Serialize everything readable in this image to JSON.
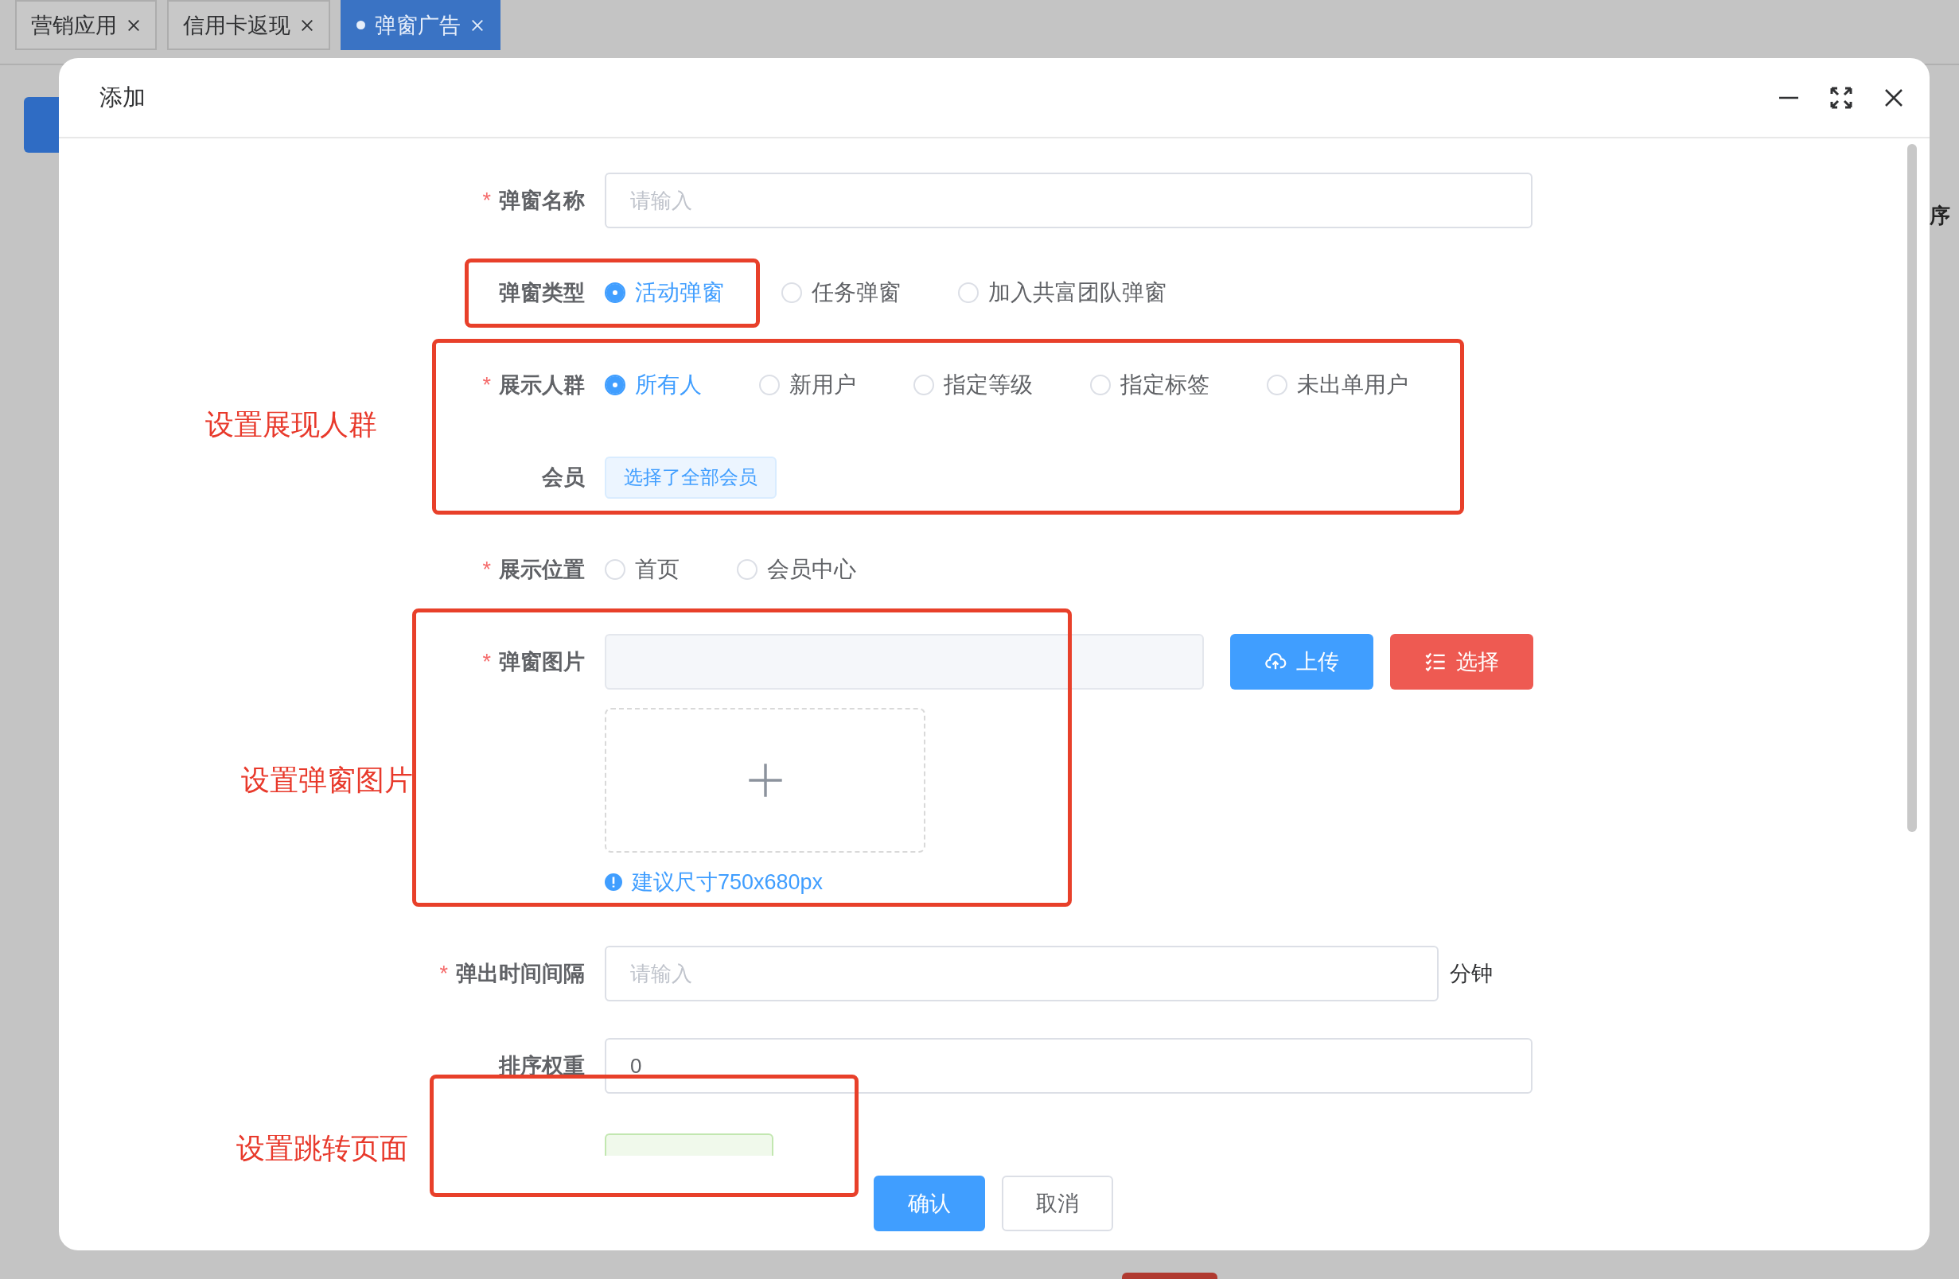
{
  "tabs": [
    {
      "label": "营销应用",
      "selected": false
    },
    {
      "label": "信用卡返现",
      "selected": false
    },
    {
      "label": "弹窗广告",
      "selected": true
    }
  ],
  "background": {
    "column_header": "序"
  },
  "dialog": {
    "title": "添加",
    "form": [
      {
        "kind": "input",
        "mark": "*",
        "label": "弹窗名称",
        "placeholder": "请输入"
      },
      {
        "kind": "radio",
        "label": "弹窗类型",
        "options": [
          {
            "label": "活动弹窗",
            "selected": true
          },
          {
            "label": "任务弹窗",
            "selected": false
          },
          {
            "label": "加入共富团队弹窗",
            "selected": false
          }
        ]
      },
      {
        "kind": "radio",
        "mark": "*",
        "label": "展示人群",
        "options": [
          {
            "label": "所有人",
            "selected": true
          },
          {
            "label": "新用户",
            "selected": false
          },
          {
            "label": "指定等级",
            "selected": false
          },
          {
            "label": "指定标签",
            "selected": false
          },
          {
            "label": "未出单用户",
            "selected": false
          }
        ]
      },
      {
        "kind": "tag",
        "label": "会员",
        "value": "选择了全部会员"
      },
      {
        "kind": "radio",
        "mark": "*",
        "label": "展示位置",
        "options": [
          {
            "label": "首页",
            "selected": false
          },
          {
            "label": "会员中心",
            "selected": false
          }
        ]
      },
      {
        "kind": "upload",
        "mark": "*",
        "label": "弹窗图片",
        "buttons": [
          {
            "kind": "upload",
            "label": "上传"
          },
          {
            "kind": "select",
            "label": "选择"
          }
        ],
        "hint": "建议尺寸750x680px"
      },
      {
        "kind": "input",
        "mark": "*",
        "label": "弹出时间间隔",
        "placeholder": "请输入",
        "unit": "分钟"
      },
      {
        "kind": "input",
        "label": "排序权重",
        "value": "0"
      },
      {
        "kind": "clipped"
      }
    ],
    "buttons": [
      {
        "kind": "primary",
        "label": "确认"
      },
      {
        "kind": "plain",
        "label": "取消"
      }
    ]
  },
  "annotations": [
    {
      "text": "设置展现人群"
    },
    {
      "text": "设置弹窗图片"
    },
    {
      "text": "设置跳转页面"
    }
  ]
}
